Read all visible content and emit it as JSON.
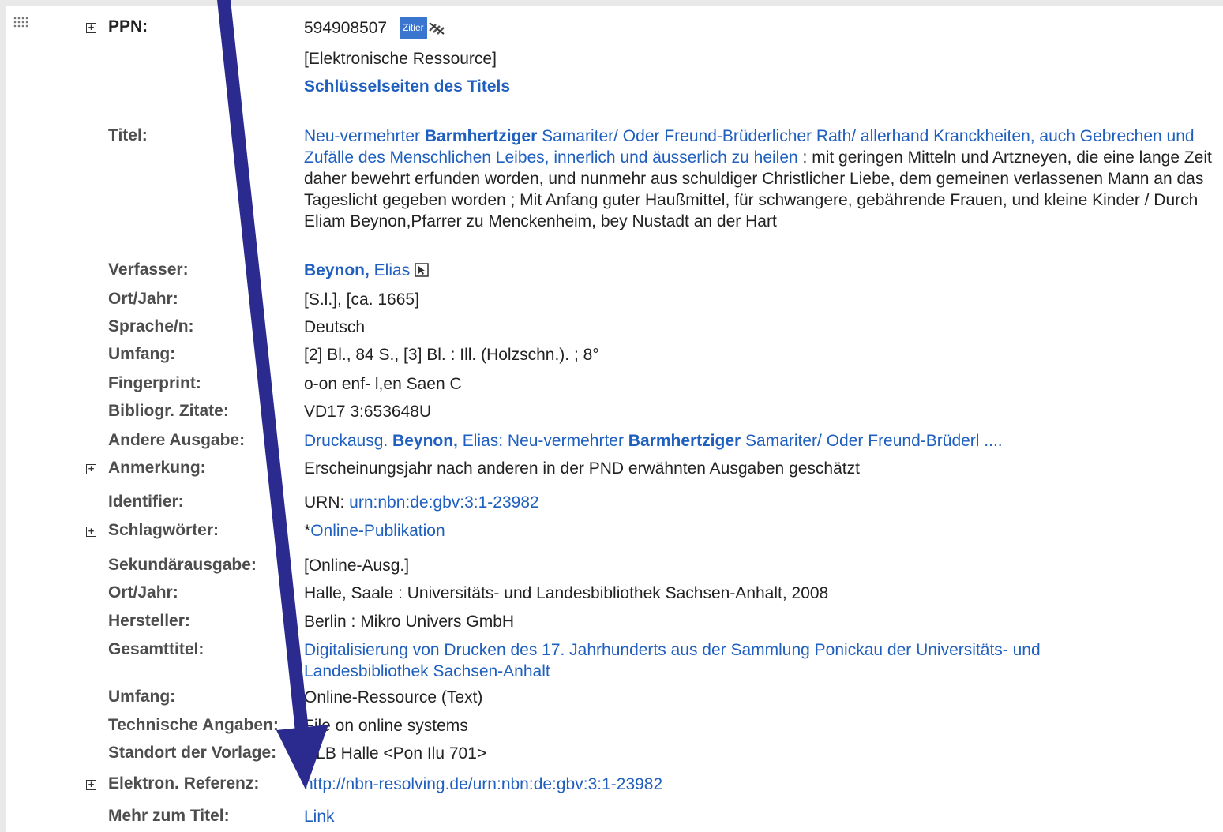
{
  "record": {
    "ppn_label": "PPN:",
    "ppn_value": "594908507",
    "zitier_label": "Zitier",
    "resource_type": "[Elektronische Ressource]",
    "key_pages_link": "Schlüsselseiten des Titels",
    "titel_label": "Titel:",
    "titel": {
      "part1": "Neu-vermehrter ",
      "part1_bold": "Barmhertziger",
      "part1_rest": " Samariter/ Oder Freund-Brüderlicher Rath/ allerhand Kranckheiten, auch Gebrechen und Zufälle des Menschlichen Leibes, innerlich und äusserlich zu heilen",
      "part2": " : mit geringen Mitteln und Artzneyen, die eine lange Zeit daher bewehrt erfunden worden, und nunmehr aus schuldiger Christlicher Liebe, dem gemeinen verlassenen Mann an das Tageslicht gegeben worden ; Mit Anfang guter Haußmittel, für schwangere, gebährende Frauen, und kleine Kinder / Durch Eliam Beynon,Pfarrer zu Menckenheim, bey Nustadt an der Hart"
    },
    "verfasser_label": "Verfasser:",
    "verfasser_bold": "Beynon,",
    "verfasser_rest": " Elias",
    "ortjahr_label": "Ort/Jahr:",
    "ortjahr": "[S.l.], [ca. 1665]",
    "sprache_label": "Sprache/n:",
    "sprache": "Deutsch",
    "umfang_label": "Umfang:",
    "umfang": "[2] Bl., 84 S., [3] Bl. : Ill. (Holzschn.). ; 8°",
    "fingerprint_label": "Fingerprint:",
    "fingerprint": "o-on enf- l,en Saen C",
    "zitate_label": "Bibliogr. Zitate:",
    "zitate": "VD17 3:653648U",
    "andere_label": "Andere Ausgabe:",
    "andere_prefix": "Druckausg. ",
    "andere_bold1": "Beynon,",
    "andere_mid": " Elias: Neu-vermehrter ",
    "andere_bold2": "Barmhertziger",
    "andere_rest": " Samariter/ Oder Freund-Brüderl ....",
    "anmerkung_label": "Anmerkung:",
    "anmerkung": "Erscheinungsjahr nach anderen in der PND erwähnten Ausgaben geschätzt",
    "identifier_label": "Identifier:",
    "identifier_prefix": "URN: ",
    "identifier_link": "urn:nbn:de:gbv:3:1-23982",
    "schlagwoerter_label": "Schlagwörter:",
    "schlagwoerter_prefix": "*",
    "schlagwoerter_link": "Online-Publikation",
    "sekundaer_label": "Sekundärausgabe:",
    "sekundaer": "[Online-Ausg.]",
    "ortjahr2_label": "Ort/Jahr:",
    "ortjahr2": "Halle, Saale : Universitäts- und Landesbibliothek Sachsen-Anhalt, 2008",
    "hersteller_label": "Hersteller:",
    "hersteller": "Berlin : Mikro Univers GmbH",
    "gesamttitel_label": "Gesamttitel:",
    "gesamttitel": "Digitalisierung von Drucken des 17. Jahrhunderts aus der Sammlung Ponickau der Universitäts- und Landesbibliothek Sachsen-Anhalt",
    "umfang2_label": "Umfang:",
    "umfang2": "Online-Ressource (Text)",
    "technische_label": "Technische Angaben:",
    "technische": "File on online systems",
    "standort_label": "Standort der Vorlage:",
    "standort": "ULB Halle <Pon Ilu 701>",
    "elektron_label": "Elektron. Referenz:",
    "elektron_link": "http://nbn-resolving.de/urn:nbn:de:gbv:3:1-23982",
    "mehr_label": "Mehr zum Titel:",
    "mehr_link": "Link"
  },
  "colors": {
    "link": "#1f5fbf",
    "label": "#4d4d4d",
    "arrow": "#2b2b8f"
  }
}
